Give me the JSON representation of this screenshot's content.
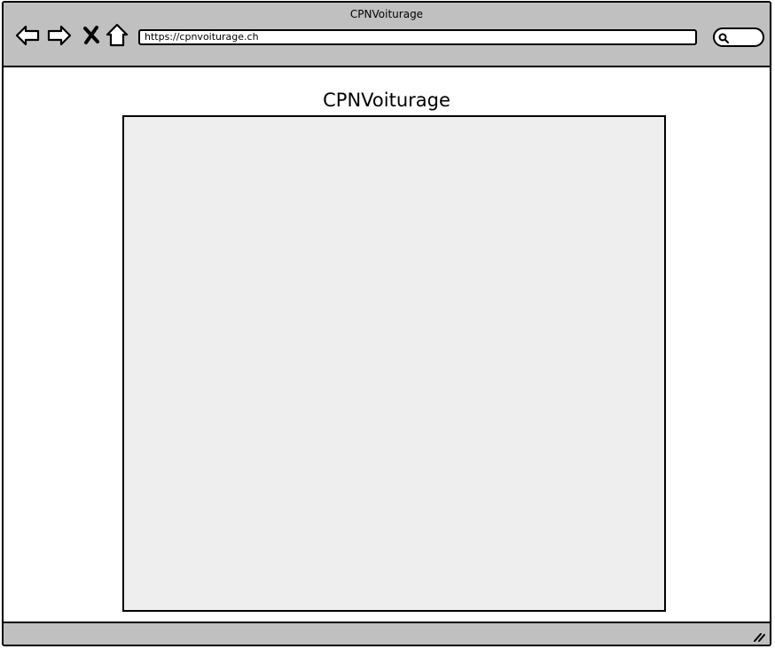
{
  "window": {
    "title": "CPNVoiturage"
  },
  "toolbar": {
    "back_icon": "arrow-left-icon",
    "forward_icon": "arrow-right-icon",
    "stop_icon": "close-icon",
    "home_icon": "home-icon",
    "url": "https://cpnvoiturage.ch",
    "search_icon": "search-icon"
  },
  "page": {
    "title": "CPNVoiturage"
  },
  "colors": {
    "chrome": "#c0c0c0",
    "content_placeholder": "#eeeeee",
    "border": "#000000"
  }
}
